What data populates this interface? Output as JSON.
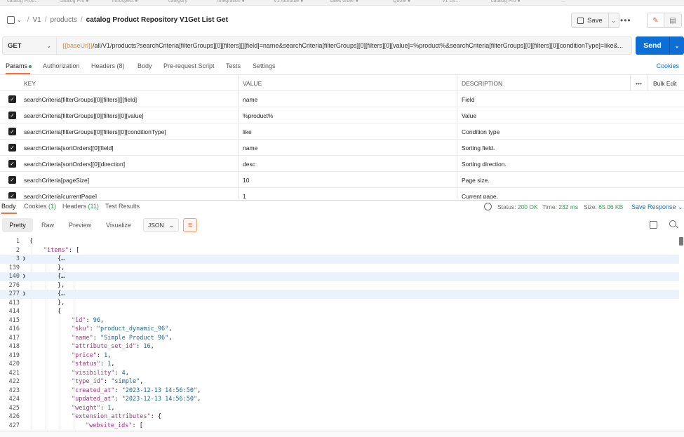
{
  "top_tabs": [
    "catalog Prod...",
    "catalog Pro ●",
    "introspect ●",
    "category",
    "integration ●",
    "V1 Attribute ●",
    "sales order ●",
    "Quote ●",
    "V1 Lis...",
    "catalog Pro ●",
    "..."
  ],
  "breadcrumb": {
    "root": "V1",
    "section": "products",
    "current": "catalog Product Repository V1Get List Get"
  },
  "toolbar": {
    "save_label": "Save"
  },
  "request": {
    "method": "GET",
    "url_var": "{{baseUrl}}",
    "url_rest": "/all/V1/products?searchCriteria[filterGroups][0][filters][][field]=name&searchCriteria[filterGroups][0][filters][0][value]=%product%&searchCriteria[filterGroups][0][filters][0][conditionType]=like&...",
    "send_label": "Send"
  },
  "request_tabs": {
    "params": "Params",
    "authorization": "Authorization",
    "headers": "Headers (8)",
    "body": "Body",
    "prerequest": "Pre-request Script",
    "tests": "Tests",
    "settings": "Settings",
    "cookies": "Cookies"
  },
  "params_table": {
    "headers": {
      "key": "KEY",
      "value": "VALUE",
      "description": "DESCRIPTION",
      "bulk_edit": "Bulk Edit"
    },
    "rows": [
      {
        "key": "searchCriteria[filterGroups][0][filters][][field]",
        "value": "name",
        "description": "Field"
      },
      {
        "key": "searchCriteria[filterGroups][0][filters][0][value]",
        "value": "%product%",
        "description": "Value"
      },
      {
        "key": "searchCriteria[filterGroups][0][filters][0][conditionType]",
        "value": "like",
        "description": "Condition type"
      },
      {
        "key": "searchCriteria[sortOrders][0][field]",
        "value": "name",
        "description": "Sorting field."
      },
      {
        "key": "searchCriteria[sortOrders][0][direction]",
        "value": "desc",
        "description": "Sorting direction."
      },
      {
        "key": "searchCriteria[pageSize]",
        "value": "10",
        "description": "Page size."
      },
      {
        "key": "searchCriteria[currentPage]",
        "value": "1",
        "description": "Current page."
      }
    ]
  },
  "response_tabs": {
    "body": "Body",
    "cookies": "Cookies",
    "cookies_count": "(1)",
    "headers": "Headers",
    "headers_count": "(11)",
    "test_results": "Test Results"
  },
  "response_meta": {
    "status_label": "Status:",
    "status_value": "200 OK",
    "time_label": "Time:",
    "time_value": "232 ms",
    "size_label": "Size:",
    "size_value": "65.06 KB",
    "save_response": "Save Response"
  },
  "response_toolbar": {
    "pretty": "Pretty",
    "raw": "Raw",
    "preview": "Preview",
    "visualize": "Visualize",
    "format": "JSON"
  },
  "code_lines": [
    {
      "ln": "1",
      "fold": "",
      "indent": 0,
      "html": "{",
      "hl": false
    },
    {
      "ln": "2",
      "fold": "",
      "indent": 1,
      "html": "<span class=\"k\">\"items\"</span>: [",
      "hl": false
    },
    {
      "ln": "3",
      "fold": ">",
      "indent": 2,
      "html": "{…",
      "hl": true
    },
    {
      "ln": "139",
      "fold": "",
      "indent": 2,
      "html": "},",
      "hl": false
    },
    {
      "ln": "140",
      "fold": ">",
      "indent": 2,
      "html": "{…",
      "hl": true
    },
    {
      "ln": "276",
      "fold": "",
      "indent": 2,
      "html": "},",
      "hl": false
    },
    {
      "ln": "277",
      "fold": ">",
      "indent": 2,
      "html": "{…",
      "hl": true
    },
    {
      "ln": "413",
      "fold": "",
      "indent": 2,
      "html": "},",
      "hl": false
    },
    {
      "ln": "414",
      "fold": "",
      "indent": 2,
      "html": "{",
      "hl": false
    },
    {
      "ln": "415",
      "fold": "",
      "indent": 3,
      "html": "<span class=\"k\">\"id\"</span>: <span class=\"n\">96</span>,",
      "hl": false
    },
    {
      "ln": "416",
      "fold": "",
      "indent": 3,
      "html": "<span class=\"k\">\"sku\"</span>: <span class=\"s\">\"product_dynamic_96\"</span>,",
      "hl": false
    },
    {
      "ln": "417",
      "fold": "",
      "indent": 3,
      "html": "<span class=\"k\">\"name\"</span>: <span class=\"s\">\"Simple Product 96\"</span>,",
      "hl": false
    },
    {
      "ln": "418",
      "fold": "",
      "indent": 3,
      "html": "<span class=\"k\">\"attribute_set_id\"</span>: <span class=\"n\">16</span>,",
      "hl": false
    },
    {
      "ln": "419",
      "fold": "",
      "indent": 3,
      "html": "<span class=\"k\">\"price\"</span>: <span class=\"n\">1</span>,",
      "hl": false
    },
    {
      "ln": "420",
      "fold": "",
      "indent": 3,
      "html": "<span class=\"k\">\"status\"</span>: <span class=\"n\">1</span>,",
      "hl": false
    },
    {
      "ln": "421",
      "fold": "",
      "indent": 3,
      "html": "<span class=\"k\">\"visibility\"</span>: <span class=\"n\">4</span>,",
      "hl": false
    },
    {
      "ln": "422",
      "fold": "",
      "indent": 3,
      "html": "<span class=\"k\">\"type_id\"</span>: <span class=\"s\">\"simple\"</span>,",
      "hl": false
    },
    {
      "ln": "423",
      "fold": "",
      "indent": 3,
      "html": "<span class=\"k\">\"created_at\"</span>: <span class=\"s\">\"2023-12-13 14:56:50\"</span>,",
      "hl": false
    },
    {
      "ln": "424",
      "fold": "",
      "indent": 3,
      "html": "<span class=\"k\">\"updated_at\"</span>: <span class=\"s\">\"2023-12-13 14:56:50\"</span>,",
      "hl": false
    },
    {
      "ln": "425",
      "fold": "",
      "indent": 3,
      "html": "<span class=\"k\">\"weight\"</span>: <span class=\"n\">1</span>,",
      "hl": false
    },
    {
      "ln": "426",
      "fold": "",
      "indent": 3,
      "html": "<span class=\"k\">\"extension_attributes\"</span>: {",
      "hl": false
    },
    {
      "ln": "427",
      "fold": "",
      "indent": 4,
      "html": "<span class=\"k\">\"website_ids\"</span>: [",
      "hl": false
    }
  ],
  "colors": {
    "accent": "#ff6c37",
    "send": "#0d6fd6",
    "status_ok": "#2e9e4f",
    "url_var": "#e08a2a"
  }
}
